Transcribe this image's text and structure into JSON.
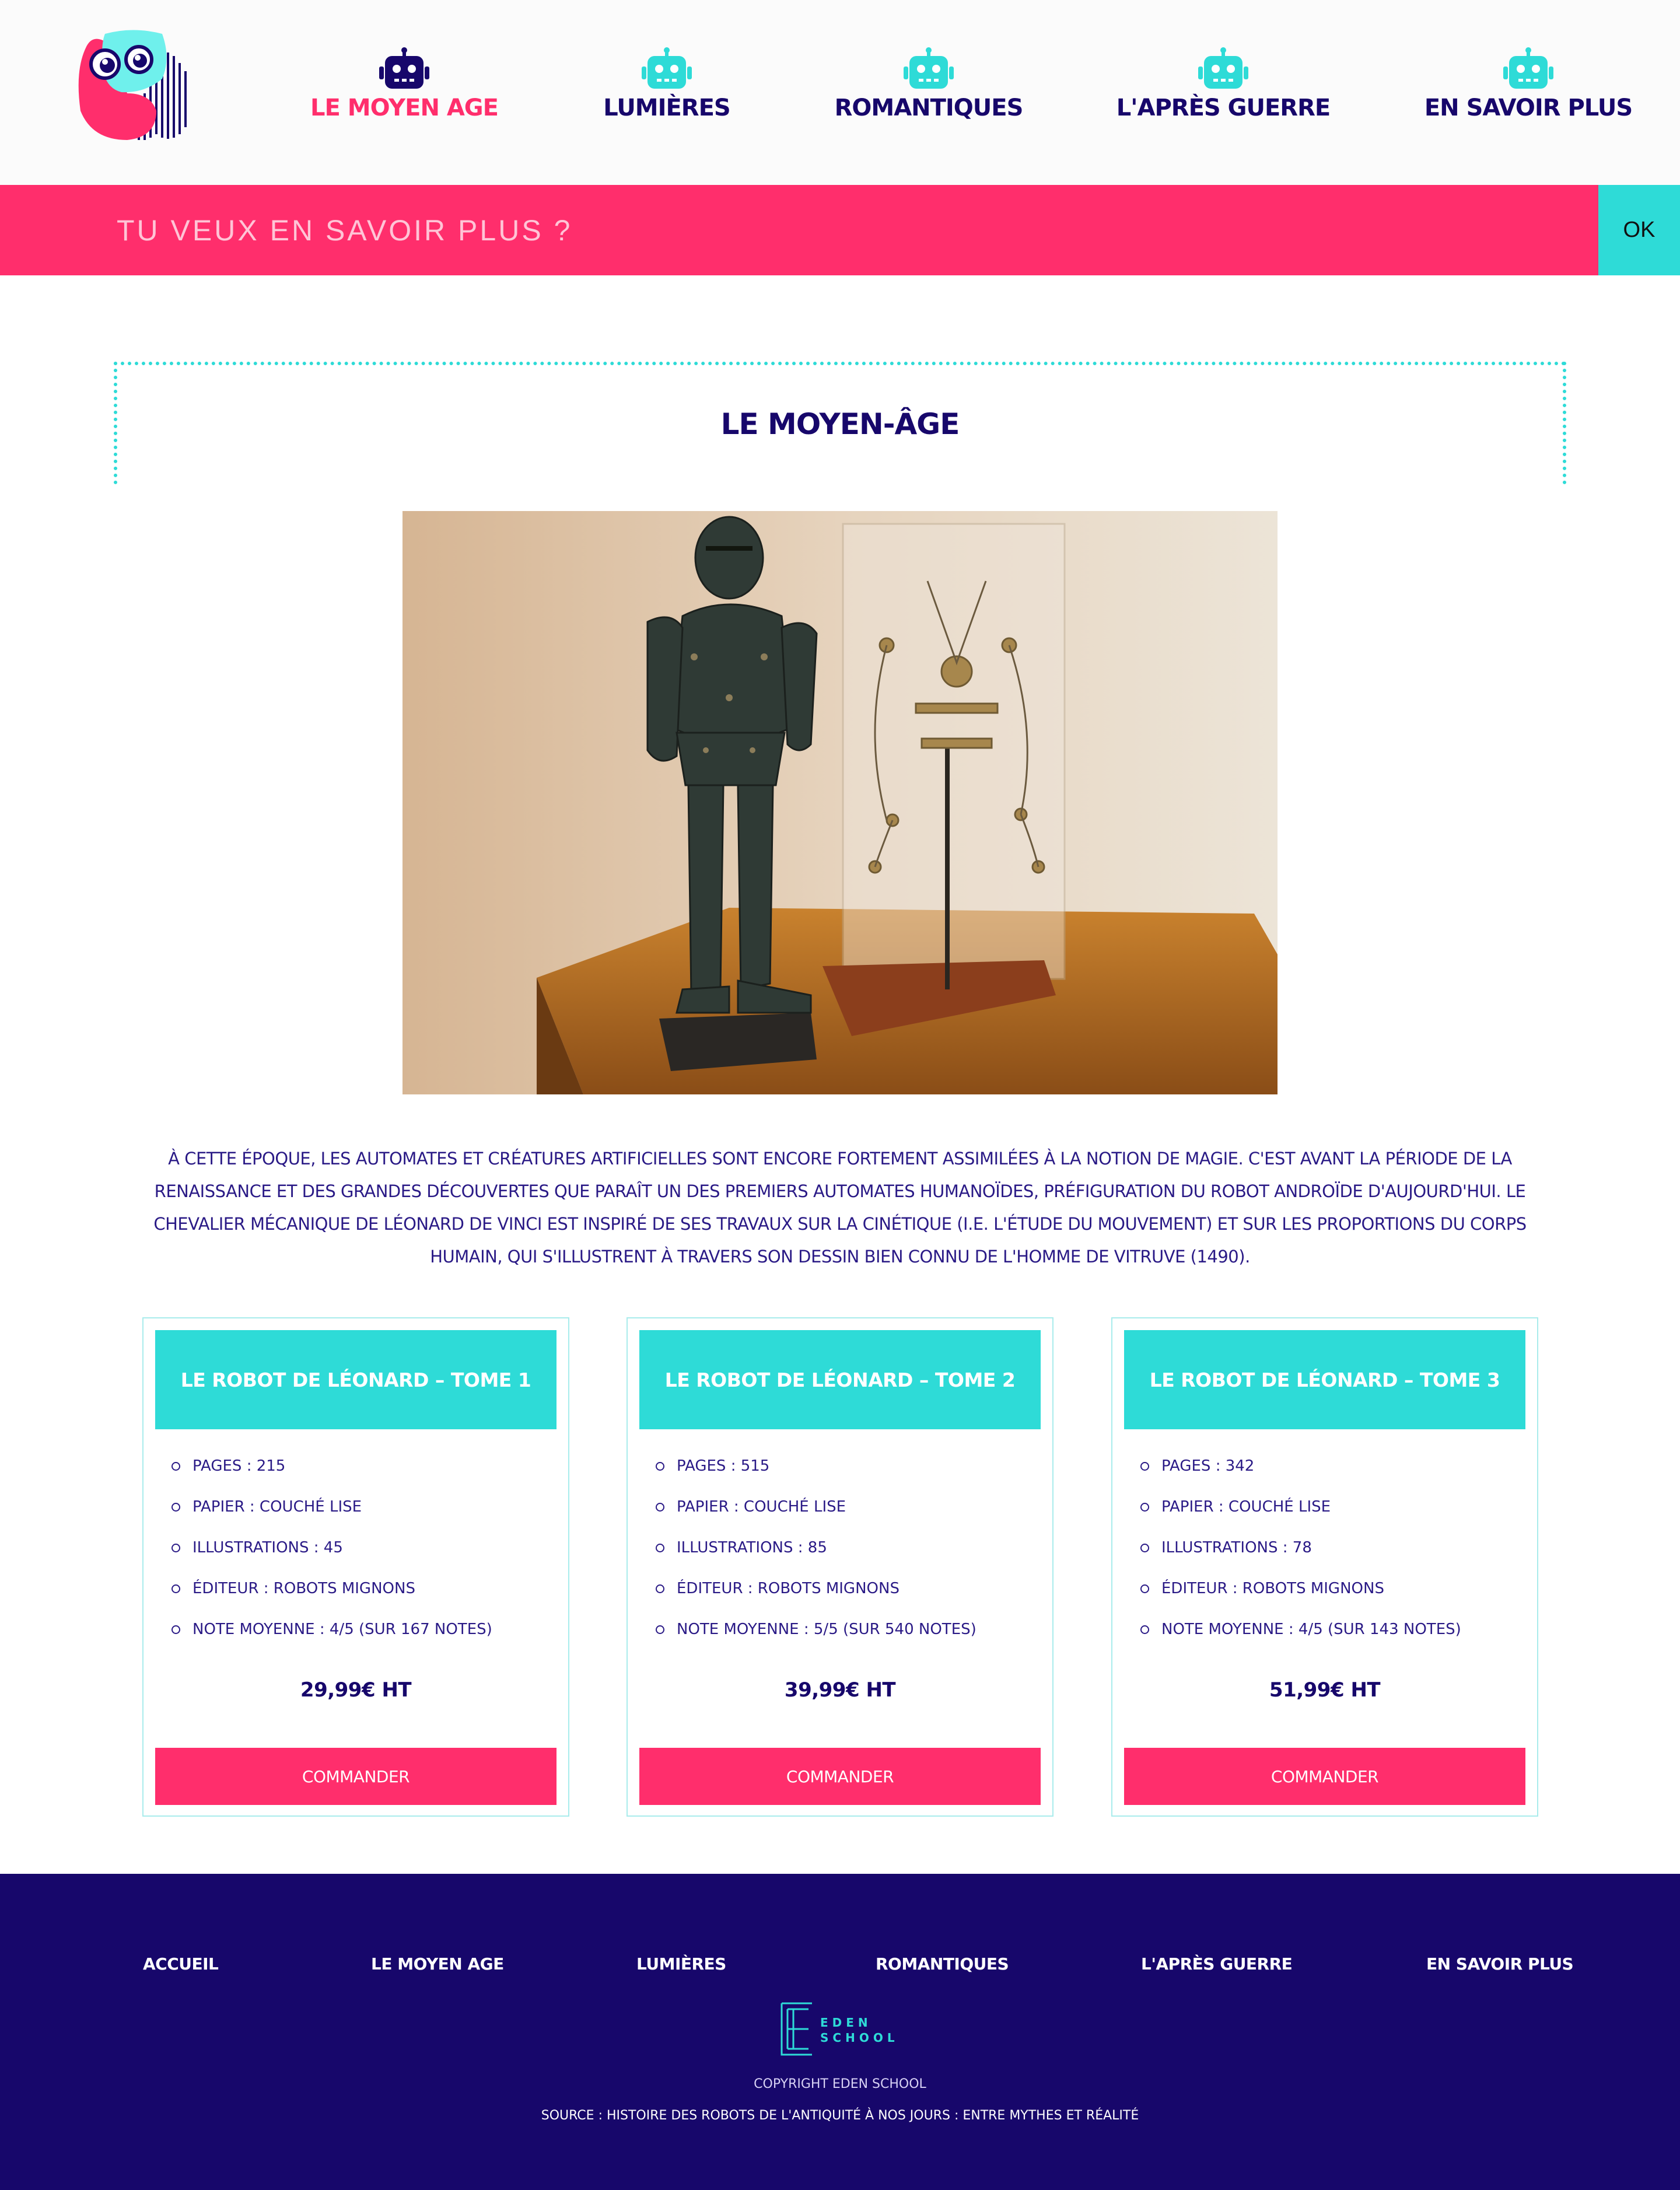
{
  "header": {
    "nav": [
      {
        "label": "LE MOYEN AGE",
        "active": true
      },
      {
        "label": "LUMIÈRES",
        "active": false
      },
      {
        "label": "ROMANTIQUES",
        "active": false
      },
      {
        "label": "L'APRÈS GUERRE",
        "active": false
      },
      {
        "label": "EN SAVOIR PLUS",
        "active": false
      }
    ]
  },
  "banner": {
    "placeholder": "TU VEUX EN SAVOIR PLUS ?",
    "ok_label": "OK"
  },
  "main": {
    "title": "LE MOYEN-ÂGE",
    "intro": "À CETTE ÉPOQUE, LES AUTOMATES ET CRÉATURES ARTIFICIELLES SONT ENCORE FORTEMENT ASSIMILÉES À LA NOTION DE MAGIE. C'EST AVANT LA PÉRIODE DE LA RENAISSANCE ET DES GRANDES DÉCOUVERTES QUE PARAÎT UN DES PREMIERS AUTOMATES HUMANOÏDES, PRÉFIGURATION DU ROBOT ANDROÏDE D'AUJOURD'HUI. LE CHEVALIER MÉCANIQUE DE LÉONARD DE VINCI EST INSPIRÉ DE SES TRAVAUX SUR LA CINÉTIQUE (I.E. L'ÉTUDE DU MOUVEMENT) ET SUR LES PROPORTIONS DU CORPS HUMAIN, QUI S'ILLUSTRENT À TRAVERS SON DESSIN BIEN CONNU DE L'HOMME DE VITRUVE (1490)."
  },
  "products": [
    {
      "title": "LE ROBOT DE LÉONARD – TOME 1",
      "specs": [
        "PAGES : 215",
        "PAPIER : COUCHÉ LISE",
        "ILLUSTRATIONS : 45",
        "ÉDITEUR : ROBOTS MIGNONS",
        "NOTE MOYENNE : 4/5 (SUR 167 NOTES)"
      ],
      "price": "29,99€ HT",
      "button": "COMMANDER"
    },
    {
      "title": "LE ROBOT DE LÉONARD – TOME 2",
      "specs": [
        "PAGES : 515",
        "PAPIER : COUCHÉ LISE",
        "ILLUSTRATIONS : 85",
        "ÉDITEUR : ROBOTS MIGNONS",
        "NOTE MOYENNE : 5/5 (SUR 540 NOTES)"
      ],
      "price": "39,99€ HT",
      "button": "COMMANDER"
    },
    {
      "title": "LE ROBOT DE LÉONARD – TOME 3",
      "specs": [
        "PAGES : 342",
        "PAPIER : COUCHÉ LISE",
        "ILLUSTRATIONS : 78",
        "ÉDITEUR : ROBOTS MIGNONS",
        "NOTE MOYENNE : 4/5 (SUR 143 NOTES)"
      ],
      "price": "51,99€ HT",
      "button": "COMMANDER"
    }
  ],
  "footer": {
    "nav": [
      "ACCUEIL",
      "LE MOYEN AGE",
      "LUMIÈRES",
      "ROMANTIQUES",
      "L'APRÈS GUERRE",
      "EN SAVOIR PLUS"
    ],
    "logo_text": [
      "EDEN",
      "SCHOOL"
    ],
    "copyright": "COPYRIGHT EDEN SCHOOL",
    "source": "SOURCE : HISTOIRE DES ROBOTS DE L'ANTIQUITÉ À NOS JOURS : ENTRE MYTHES ET RÉALITÉ"
  },
  "colors": {
    "navy": "#17076b",
    "pink": "#ff2e6c",
    "cyan": "#2edbd7"
  },
  "icons": {
    "nav_icon": "robot-head-icon",
    "logo": "robot-face-logo"
  }
}
